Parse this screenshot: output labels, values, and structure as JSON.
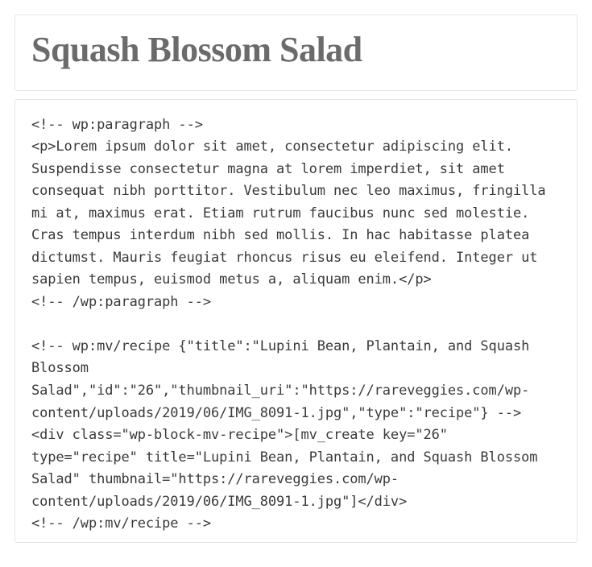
{
  "header": {
    "title": "Squash Blossom Salad"
  },
  "code": {
    "content": "<!-- wp:paragraph -->\n<p>Lorem ipsum dolor sit amet, consectetur adipiscing elit. Suspendisse consectetur magna at lorem imperdiet, sit amet consequat nibh porttitor. Vestibulum nec leo maximus, fringilla mi at, maximus erat. Etiam rutrum faucibus nunc sed molestie. Cras tempus interdum nibh sed mollis. In hac habitasse platea dictumst. Mauris feugiat rhoncus risus eu eleifend. Integer ut sapien tempus, euismod metus a, aliquam enim.</p>\n<!-- /wp:paragraph -->\n\n<!-- wp:mv/recipe {\"title\":\"Lupini Bean, Plantain, and Squash Blossom Salad\",\"id\":\"26\",\"thumbnail_uri\":\"https://rareveggies.com/wp-content/uploads/2019/06/IMG_8091-1.jpg\",\"type\":\"recipe\"} -->\n<div class=\"wp-block-mv-recipe\">[mv_create key=\"26\" type=\"recipe\" title=\"Lupini Bean, Plantain, and Squash Blossom Salad\" thumbnail=\"https://rareveggies.com/wp-content/uploads/2019/06/IMG_8091-1.jpg\"]</div>\n<!-- /wp:mv/recipe -->"
  }
}
